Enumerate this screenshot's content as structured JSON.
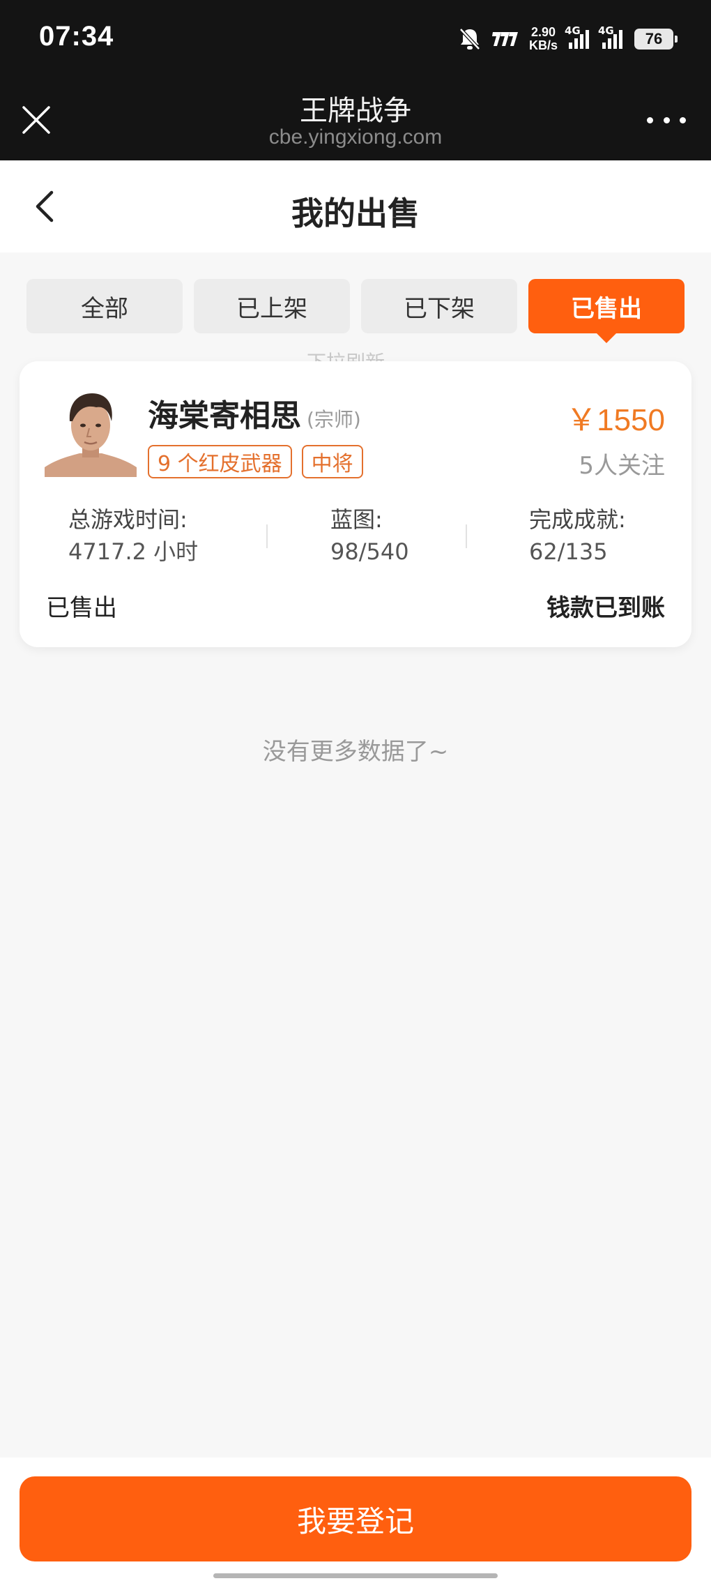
{
  "status_bar": {
    "time": "07:34",
    "net_speed_value": "2.90",
    "net_speed_unit": "KB/s",
    "signal1_label": "4G",
    "signal2_label": "4G",
    "battery": "76",
    "icons": [
      "mute-bell-icon",
      "carrier-logo-icon",
      "signal-icon",
      "signal-icon",
      "battery-icon"
    ]
  },
  "browser": {
    "title": "王牌战争",
    "url": "cbe.yingxiong.com"
  },
  "header": {
    "title": "我的出售"
  },
  "tabs": [
    {
      "label": "全部",
      "active": false
    },
    {
      "label": "已上架",
      "active": false
    },
    {
      "label": "已下架",
      "active": false
    },
    {
      "label": "已售出",
      "active": true
    }
  ],
  "scroll_ghost_text": "下拉刷新",
  "listing": {
    "name": "海棠寄相思",
    "rank": "(宗师)",
    "tags": [
      "9 个红皮武器",
      "中将"
    ],
    "price": "￥1550",
    "followers": "5人关注",
    "stats": [
      {
        "label": "总游戏时间:",
        "value": "4717.2 小时"
      },
      {
        "label": "蓝图:",
        "value": "98/540"
      },
      {
        "label": "完成成就:",
        "value": "62/135"
      }
    ],
    "status": "已售出",
    "payment_status": "钱款已到账"
  },
  "list_footer": "没有更多数据了~",
  "bottom": {
    "register_label": "我要登记"
  },
  "colors": {
    "accent": "#ff5f0f",
    "price": "#f07a23",
    "tag": "#e4702d"
  }
}
